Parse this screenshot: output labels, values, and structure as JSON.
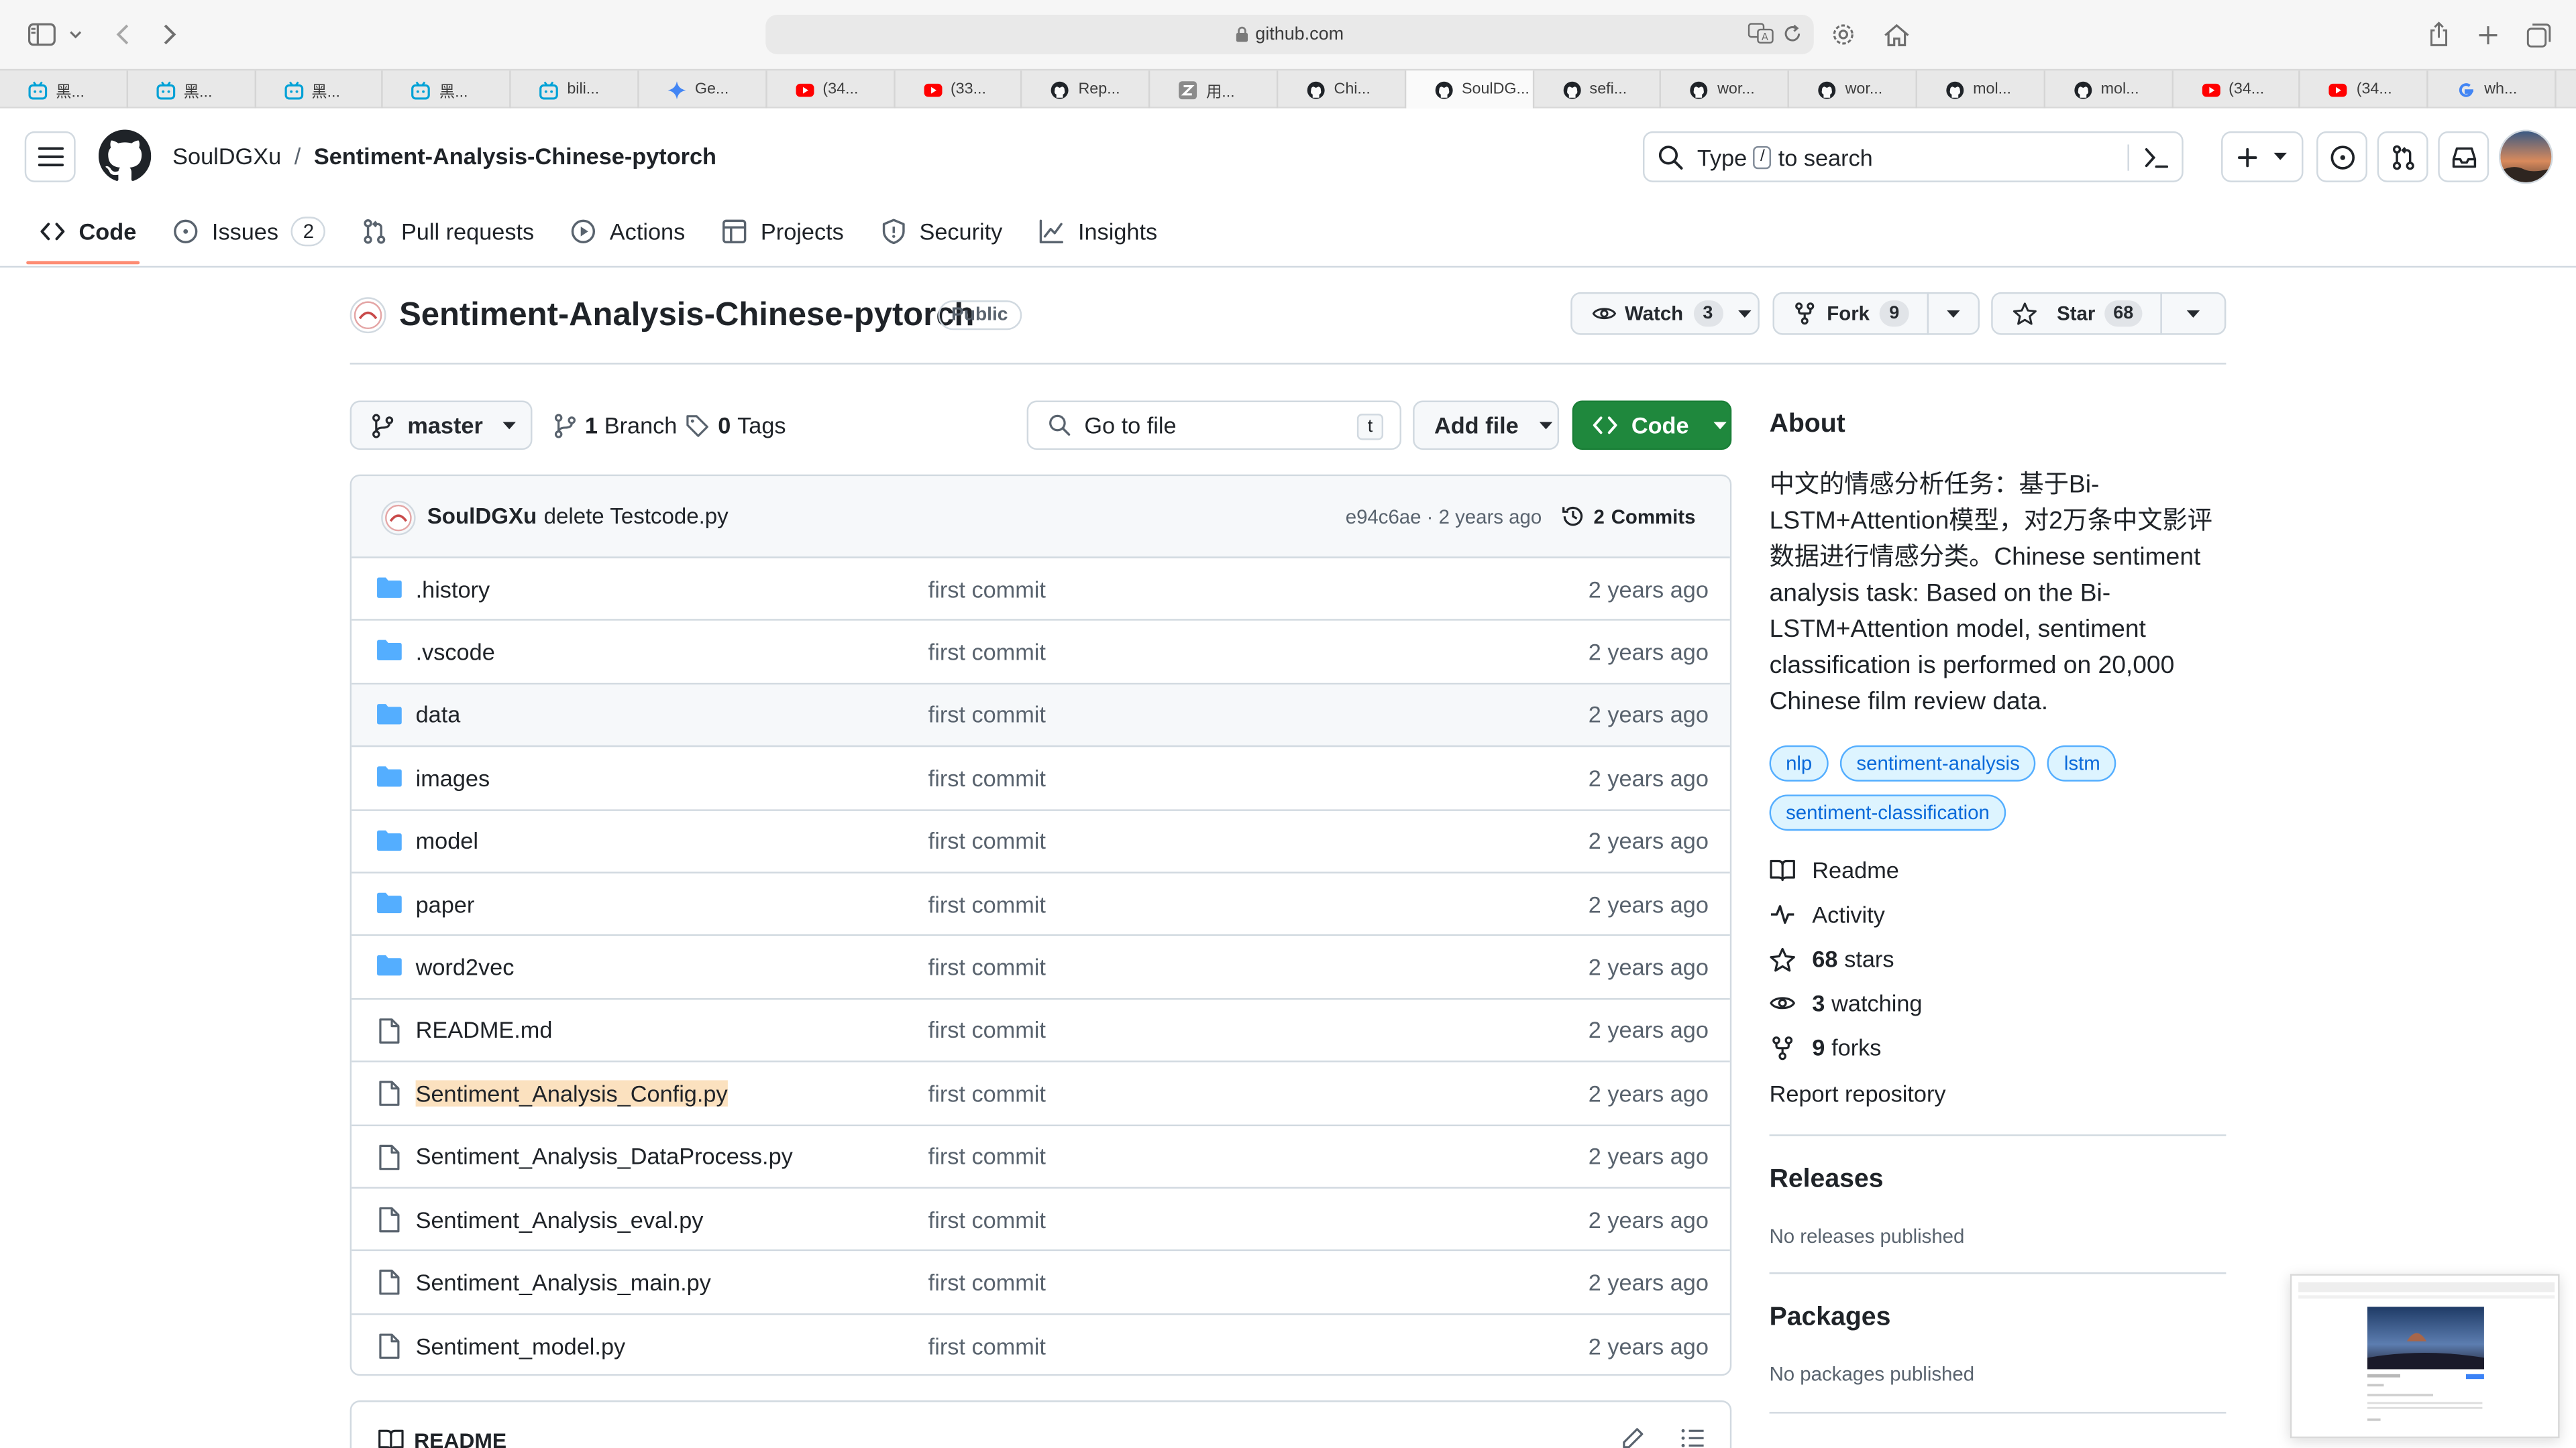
{
  "browser": {
    "url": "github.com",
    "tabs": [
      {
        "label": "黑...",
        "icon": "bilibili-icon",
        "color": "#00a1d6"
      },
      {
        "label": "黑...",
        "icon": "bilibili-icon",
        "color": "#00a1d6"
      },
      {
        "label": "黑...",
        "icon": "bilibili-icon",
        "color": "#00a1d6"
      },
      {
        "label": "黑...",
        "icon": "bilibili-icon",
        "color": "#00a1d6"
      },
      {
        "label": "bili...",
        "icon": "bilibili-icon",
        "color": "#00a1d6"
      },
      {
        "label": "Ge...",
        "icon": "gemini-icon",
        "color": "#4285f4"
      },
      {
        "label": "(34...",
        "icon": "youtube-icon",
        "color": "#ff0000"
      },
      {
        "label": "(33...",
        "icon": "youtube-icon",
        "color": "#ff0000"
      },
      {
        "label": "Rep...",
        "icon": "github-icon",
        "color": "#1f2328"
      },
      {
        "label": "用...",
        "icon": "z-icon",
        "color": "#8b8b8b"
      },
      {
        "label": "Chi...",
        "icon": "github-icon",
        "color": "#1f2328"
      },
      {
        "label": "SoulDG...",
        "icon": "github-icon",
        "color": "#1f2328",
        "active": true
      },
      {
        "label": "sefi...",
        "icon": "github-icon",
        "color": "#1f2328"
      },
      {
        "label": "wor...",
        "icon": "github-icon",
        "color": "#1f2328"
      },
      {
        "label": "wor...",
        "icon": "github-icon",
        "color": "#1f2328"
      },
      {
        "label": "mol...",
        "icon": "github-icon",
        "color": "#1f2328"
      },
      {
        "label": "mol...",
        "icon": "github-icon",
        "color": "#1f2328"
      },
      {
        "label": "(34...",
        "icon": "youtube-icon",
        "color": "#ff0000"
      },
      {
        "label": "(34...",
        "icon": "youtube-icon",
        "color": "#ff0000"
      },
      {
        "label": "wh...",
        "icon": "google-icon",
        "color": "#4285f4"
      }
    ]
  },
  "header": {
    "owner": "SoulDGXu",
    "separator": "/",
    "repo": "Sentiment-Analysis-Chinese-pytorch",
    "search_pre": "Type",
    "search_key": "/",
    "search_post": "to search"
  },
  "nav": {
    "code": "Code",
    "issues": "Issues",
    "issues_count": "2",
    "pulls": "Pull requests",
    "actions": "Actions",
    "projects": "Projects",
    "security": "Security",
    "insights": "Insights"
  },
  "repo": {
    "name": "Sentiment-Analysis-Chinese-pytorch",
    "visibility": "Public",
    "watch_label": "Watch",
    "watch_count": "3",
    "fork_label": "Fork",
    "fork_count": "9",
    "star_label": "Star",
    "star_count": "68"
  },
  "toolbar": {
    "branch": "master",
    "branches_count": "1",
    "branches_label": "Branch",
    "tags_count": "0",
    "tags_label": "Tags",
    "goto_placeholder": "Go to file",
    "goto_key": "t",
    "add_file": "Add file",
    "code": "Code"
  },
  "commit": {
    "author": "SoulDGXu",
    "message": "delete Testcode.py",
    "hash_age": "e94c6ae · 2 years ago",
    "commits_count": "2",
    "commits_label": "Commits"
  },
  "files": [
    {
      "name": ".history",
      "type": "dir",
      "message": "first commit",
      "age": "2 years ago"
    },
    {
      "name": ".vscode",
      "type": "dir",
      "message": "first commit",
      "age": "2 years ago"
    },
    {
      "name": "data",
      "type": "dir",
      "message": "first commit",
      "age": "2 years ago"
    },
    {
      "name": "images",
      "type": "dir",
      "message": "first commit",
      "age": "2 years ago"
    },
    {
      "name": "model",
      "type": "dir",
      "message": "first commit",
      "age": "2 years ago"
    },
    {
      "name": "paper",
      "type": "dir",
      "message": "first commit",
      "age": "2 years ago"
    },
    {
      "name": "word2vec",
      "type": "dir",
      "message": "first commit",
      "age": "2 years ago"
    },
    {
      "name": "README.md",
      "type": "file",
      "message": "first commit",
      "age": "2 years ago"
    },
    {
      "name": "Sentiment_Analysis_Config.py",
      "type": "file",
      "message": "first commit",
      "age": "2 years ago"
    },
    {
      "name": "Sentiment_Analysis_DataProcess.py",
      "type": "file",
      "message": "first commit",
      "age": "2 years ago"
    },
    {
      "name": "Sentiment_Analysis_eval.py",
      "type": "file",
      "message": "first commit",
      "age": "2 years ago"
    },
    {
      "name": "Sentiment_Analysis_main.py",
      "type": "file",
      "message": "first commit",
      "age": "2 years ago"
    },
    {
      "name": "Sentiment_model.py",
      "type": "file",
      "message": "first commit",
      "age": "2 years ago"
    }
  ],
  "readme": {
    "title": "README"
  },
  "about": {
    "title": "About",
    "description": "中文的情感分析任务：基于Bi-LSTM+Attention模型，对2万条中文影评数据进行情感分类。Chinese sentiment analysis task: Based on the Bi-LSTM+Attention model, sentiment classification is performed on 20,000 Chinese film review data.",
    "topics": [
      "nlp",
      "sentiment-analysis",
      "lstm",
      "sentiment-classification"
    ],
    "readme": "Readme",
    "activity": "Activity",
    "stars_count": "68",
    "stars_label": "stars",
    "watching_count": "3",
    "watching_label": "watching",
    "forks_count": "9",
    "forks_label": "forks",
    "report": "Report repository"
  },
  "releases": {
    "title": "Releases",
    "sub": "No releases published"
  },
  "packages": {
    "title": "Packages",
    "sub": "No packages published"
  },
  "colors": {
    "accent_green": "#1f883d",
    "link_blue": "#0969da",
    "folder_blue": "#54aeff",
    "nav_underline": "#fd8c73",
    "highlight": "#fbe1bf"
  }
}
